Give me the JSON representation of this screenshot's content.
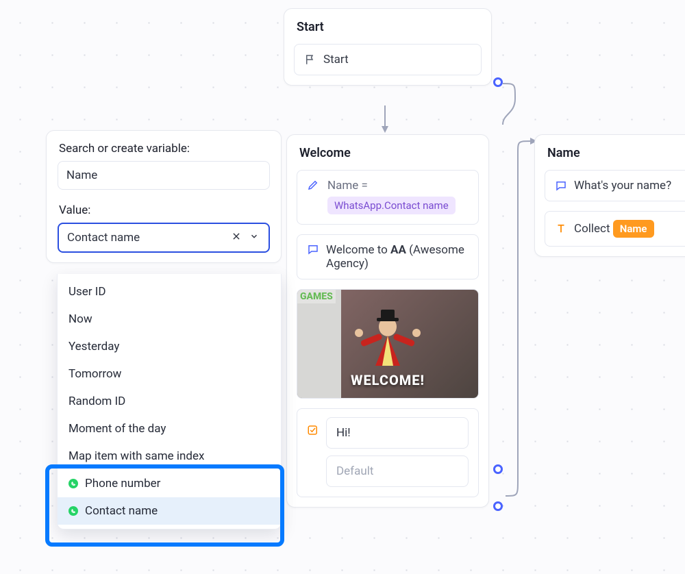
{
  "start": {
    "title": "Start",
    "step_label": "Start"
  },
  "welcome": {
    "title": "Welcome",
    "var_name": "Name",
    "equals": " =",
    "var_value_chip": "WhatsApp.Contact name",
    "message_pre": "Welcome to ",
    "message_bold": "AA",
    "message_post": " (Awesome Agency)",
    "image_caption": "WELCOME!",
    "image_badge": "GAMES",
    "choice_input": "Hi!",
    "choice_default": "Default"
  },
  "name": {
    "title": "Name",
    "question": "What's your name?",
    "collect_label": "Collect ",
    "collect_chip": "Name"
  },
  "panel": {
    "label_search": "Search or create variable:",
    "search_value": "Name",
    "label_value": "Value:",
    "combo_value": "Contact name"
  },
  "dropdown": {
    "items": [
      {
        "label": "User ID",
        "wa": false
      },
      {
        "label": "Now",
        "wa": false
      },
      {
        "label": "Yesterday",
        "wa": false
      },
      {
        "label": "Tomorrow",
        "wa": false
      },
      {
        "label": "Random ID",
        "wa": false
      },
      {
        "label": "Moment of the day",
        "wa": false
      },
      {
        "label": "Map item with same index",
        "wa": false
      },
      {
        "label": "Phone number",
        "wa": true
      },
      {
        "label": "Contact name",
        "wa": true
      }
    ],
    "selected_index": 8
  }
}
